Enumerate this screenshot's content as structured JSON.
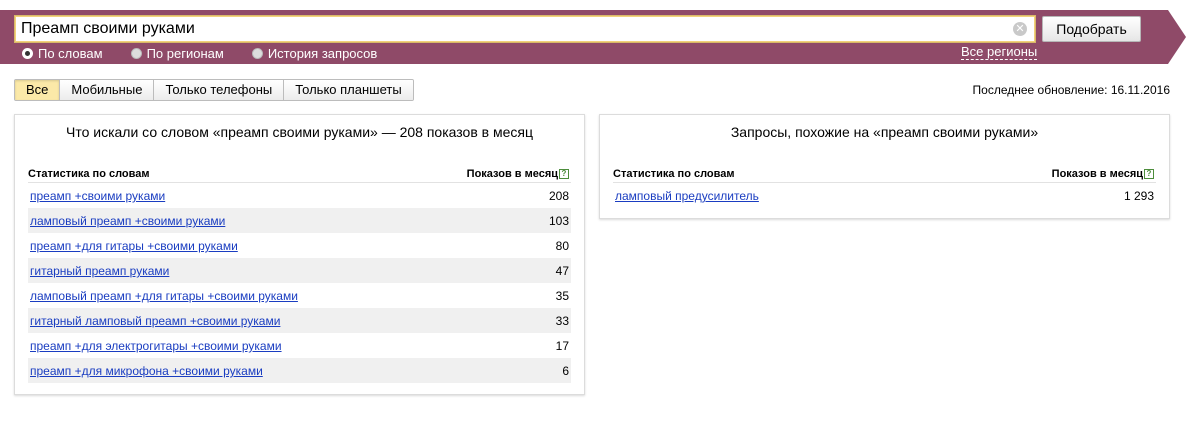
{
  "search": {
    "query": "Преамп своими руками",
    "submit_label": "Подобрать",
    "clear_glyph": "✕",
    "modes": [
      {
        "label": "По словам",
        "selected": true
      },
      {
        "label": "По регионам",
        "selected": false
      },
      {
        "label": "История запросов",
        "selected": false
      }
    ],
    "regions_label": "Все регионы"
  },
  "colors": {
    "band": "#8f4a68",
    "link": "#1a3dc1",
    "active_tab": "#fbe9a8",
    "row_alt": "#f0f0f0"
  },
  "tabs": [
    {
      "label": "Все",
      "active": true
    },
    {
      "label": "Мобильные",
      "active": false
    },
    {
      "label": "Только телефоны",
      "active": false
    },
    {
      "label": "Только планшеты",
      "active": false
    }
  ],
  "last_update": "Последнее обновление: 16.11.2016",
  "left_panel": {
    "title": "Что искали со словом «преамп своими руками» — 208 показов в месяц",
    "col_left": "Статистика по словам",
    "col_right": "Показов в месяц",
    "help_glyph": "?",
    "rows": [
      {
        "keyword": "преамп +своими руками",
        "count": "208"
      },
      {
        "keyword": "ламповый преамп +своими руками",
        "count": "103"
      },
      {
        "keyword": "преамп +для гитары +своими руками",
        "count": "80"
      },
      {
        "keyword": "гитарный преамп руками",
        "count": "47"
      },
      {
        "keyword": "ламповый преамп +для гитары +своими руками",
        "count": "35"
      },
      {
        "keyword": "гитарный ламповый преамп +своими руками",
        "count": "33"
      },
      {
        "keyword": "преамп +для электрогитары +своими руками",
        "count": "17"
      },
      {
        "keyword": "преамп +для микрофона +своими руками",
        "count": "6"
      }
    ]
  },
  "right_panel": {
    "title": "Запросы, похожие на «преамп своими руками»",
    "col_left": "Статистика по словам",
    "col_right": "Показов в месяц",
    "help_glyph": "?",
    "rows": [
      {
        "keyword": "ламповый предусилитель",
        "count": "1 293"
      }
    ]
  }
}
